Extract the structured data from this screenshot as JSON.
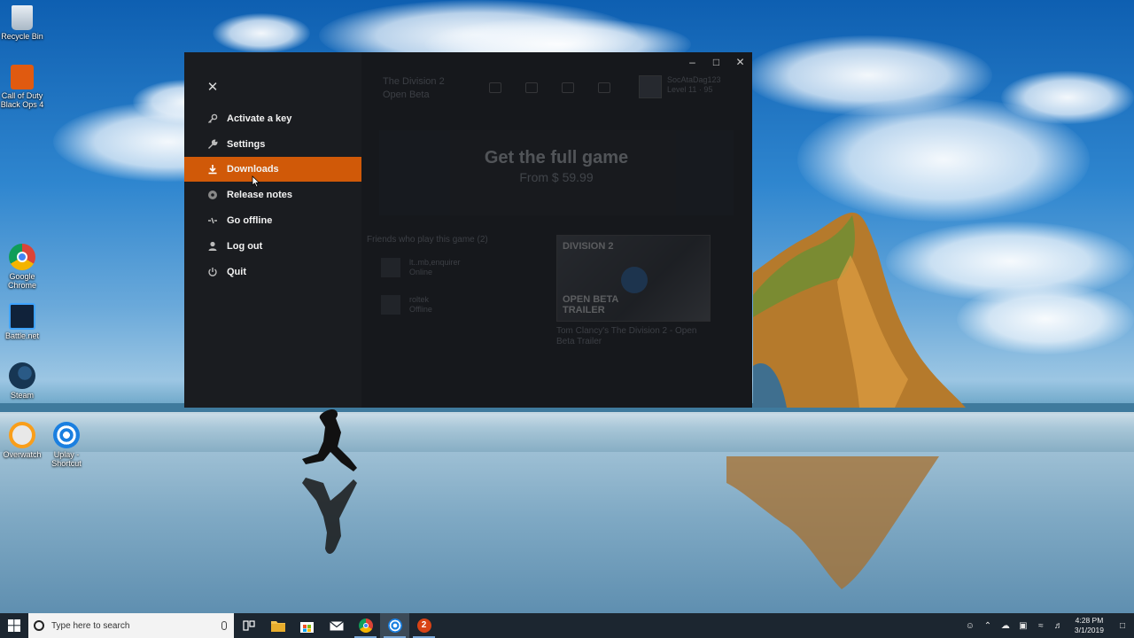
{
  "desktop": {
    "icons": [
      {
        "label": "Recycle Bin",
        "icon": "recycle-bin-icon"
      },
      {
        "label": "Call of Duty Black Ops 4",
        "icon": "black-ops-4-icon"
      },
      {
        "label": "Google Chrome",
        "icon": "chrome-icon"
      },
      {
        "label": "Battle.net",
        "icon": "battlenet-icon"
      },
      {
        "label": "Steam",
        "icon": "steam-icon"
      },
      {
        "label": "Overwatch",
        "icon": "overwatch-icon"
      },
      {
        "label": "Uplay - Shortcut",
        "icon": "uplay-icon"
      }
    ]
  },
  "window": {
    "menu": {
      "close_icon": "close-icon",
      "items": [
        {
          "label": "Activate a key",
          "icon": "key-icon",
          "active": false
        },
        {
          "label": "Settings",
          "icon": "wrench-icon",
          "active": false
        },
        {
          "label": "Downloads",
          "icon": "download-icon",
          "active": true
        },
        {
          "label": "Release notes",
          "icon": "disc-icon",
          "active": false
        },
        {
          "label": "Go offline",
          "icon": "offline-icon",
          "active": false
        },
        {
          "label": "Log out",
          "icon": "person-icon",
          "active": false
        },
        {
          "label": "Quit",
          "icon": "power-icon",
          "active": false
        }
      ]
    },
    "content": {
      "game_title_line1": "The Division 2",
      "game_title_line2": "Open Beta",
      "profile_name": "SocAtaDag123",
      "profile_level": "Level 11",
      "profile_units": "95",
      "promo_title": "Get the full game",
      "promo_price": "From $ 59.99",
      "friends_title": "Friends who play this game (2)",
      "friends": [
        {
          "name": "lt..mb,enquirer",
          "status": "Online"
        },
        {
          "name": "roltek",
          "status": "Offline"
        }
      ],
      "trailer_brand": "DIVISION 2",
      "trailer_tag": "OPEN BETA TRAILER",
      "trailer_caption": "Tom Clancy's The Division 2 - Open Beta Trailer"
    }
  },
  "taskbar": {
    "search_placeholder": "Type here to search",
    "time": "4:28 PM",
    "date": "3/1/2019",
    "accent": "#d05908"
  }
}
